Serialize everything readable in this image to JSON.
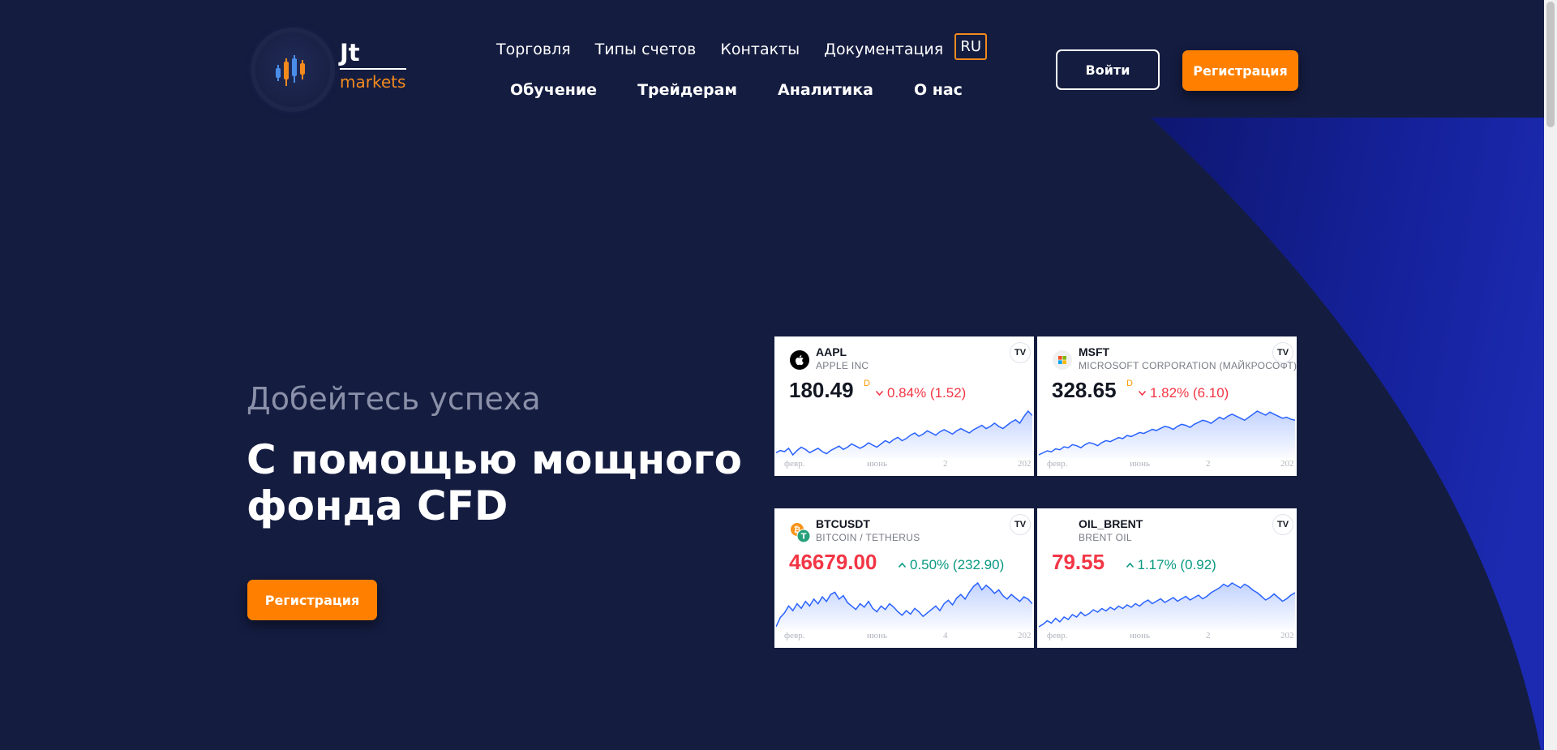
{
  "logo": {
    "jt": "Jt",
    "markets": "markets"
  },
  "nav": {
    "top": [
      "Торговля",
      "Типы счетов",
      "Контакты",
      "Документация"
    ],
    "lang": "RU",
    "bottom": [
      "Обучение",
      "Трейдерам",
      "Аналитика",
      "О нас"
    ]
  },
  "header": {
    "login_label": "Войти",
    "register_label": "Регистрация"
  },
  "hero": {
    "subtitle": "Добейтесь успеха",
    "title": "С помощью мощного фонда CFD",
    "register_label": "Регистрация"
  },
  "colors": {
    "background": "#141c40",
    "accent": "#ff8000",
    "arc": "#16228a",
    "down": "#f23645",
    "up": "#089981"
  },
  "widgets": [
    {
      "symbol": "AAPL",
      "name": "APPLE INC",
      "price": "180.49",
      "delayed": "D",
      "change": "0.84% (1.52)",
      "direction": "down",
      "price_color": "default",
      "icon": "apple-icon",
      "ticks": [
        "февр.",
        "июнь",
        "2",
        "202"
      ],
      "series": [
        22,
        24,
        23,
        26,
        20,
        24,
        27,
        25,
        22,
        24,
        26,
        23,
        21,
        24,
        26,
        28,
        25,
        27,
        30,
        28,
        26,
        28,
        31,
        29,
        27,
        30,
        33,
        31,
        34,
        36,
        33,
        35,
        38,
        40,
        37,
        39,
        42,
        40,
        38,
        41,
        43,
        41,
        39,
        42,
        44,
        42,
        40,
        43,
        45,
        47,
        44,
        46,
        49,
        46,
        44,
        47,
        50,
        52,
        49,
        55,
        60,
        56
      ]
    },
    {
      "symbol": "MSFT",
      "name": "MICROSOFT CORPORATION (МАЙКРОСОФТ)",
      "price": "328.65",
      "delayed": "D",
      "change": "1.82% (6.10)",
      "direction": "down",
      "price_color": "default",
      "icon": "microsoft-icon",
      "ticks": [
        "февр.",
        "июнь",
        "2",
        "202"
      ],
      "series": [
        18,
        20,
        22,
        21,
        24,
        23,
        26,
        25,
        28,
        27,
        25,
        28,
        30,
        29,
        27,
        30,
        32,
        31,
        33,
        35,
        34,
        37,
        36,
        38,
        40,
        39,
        41,
        43,
        42,
        44,
        46,
        45,
        43,
        46,
        48,
        47,
        45,
        48,
        50,
        52,
        51,
        49,
        52,
        55,
        53,
        56,
        58,
        56,
        54,
        52,
        55,
        58,
        61,
        59,
        57,
        60,
        58,
        56,
        54,
        55,
        53,
        52
      ]
    },
    {
      "symbol": "BTCUSDT",
      "name": "BITCOIN / TETHERUS",
      "price": "46679.00",
      "delayed": "",
      "change": "0.50% (232.90)",
      "direction": "up",
      "price_color": "red",
      "icon": "bitcoin-icon",
      "ticks": [
        "февр.",
        "июнь",
        "4",
        "202"
      ],
      "series": [
        20,
        28,
        32,
        38,
        34,
        40,
        36,
        42,
        38,
        44,
        40,
        46,
        42,
        48,
        50,
        44,
        47,
        41,
        38,
        35,
        40,
        37,
        42,
        36,
        33,
        38,
        35,
        40,
        37,
        33,
        30,
        34,
        31,
        36,
        33,
        29,
        32,
        35,
        38,
        34,
        40,
        43,
        39,
        45,
        48,
        44,
        50,
        55,
        58,
        52,
        56,
        53,
        49,
        52,
        47,
        44,
        48,
        45,
        42,
        46,
        44,
        40
      ]
    },
    {
      "symbol": "OIL_BRENT",
      "name": "BRENT OIL",
      "price": "79.55",
      "delayed": "",
      "change": "1.17% (0.92)",
      "direction": "up",
      "price_color": "red",
      "icon": "oil-icon",
      "ticks": [
        "февр.",
        "июнь",
        "2",
        "202"
      ],
      "series": [
        20,
        22,
        25,
        23,
        27,
        24,
        28,
        26,
        30,
        28,
        32,
        29,
        31,
        34,
        32,
        35,
        33,
        36,
        34,
        37,
        35,
        38,
        36,
        39,
        37,
        40,
        42,
        39,
        41,
        43,
        40,
        42,
        44,
        41,
        43,
        45,
        42,
        44,
        46,
        43,
        45,
        48,
        50,
        52,
        55,
        53,
        56,
        54,
        52,
        55,
        53,
        50,
        48,
        45,
        42,
        44,
        47,
        44,
        41,
        43,
        46,
        48
      ]
    }
  ]
}
